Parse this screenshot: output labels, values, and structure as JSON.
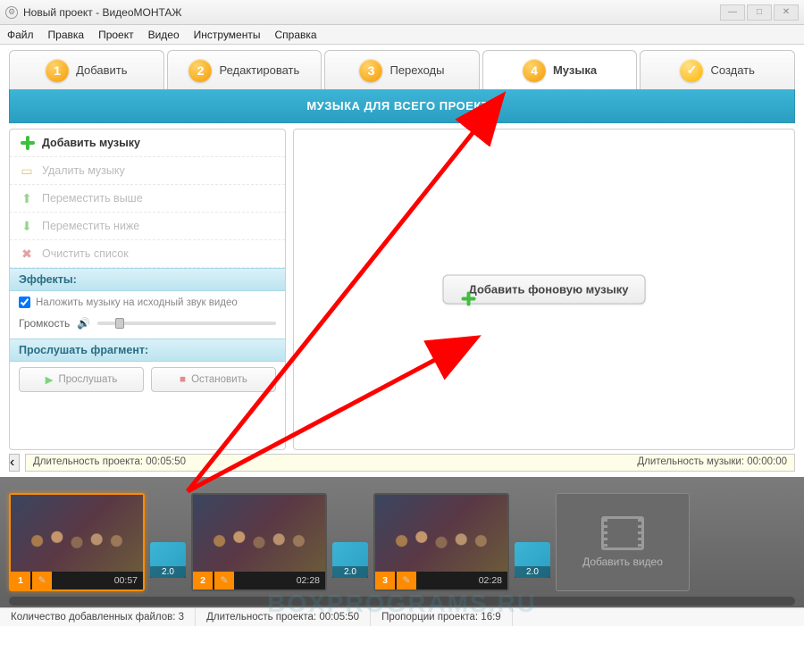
{
  "window": {
    "title": "Новый проект - ВидеоМОНТАЖ"
  },
  "menu": {
    "file": "Файл",
    "edit": "Правка",
    "project": "Проект",
    "video": "Видео",
    "tools": "Инструменты",
    "help": "Справка"
  },
  "tabs": {
    "add": "Добавить",
    "edit": "Редактировать",
    "transitions": "Переходы",
    "music": "Музыка",
    "create": "Создать"
  },
  "banner": "МУЗЫКА ДЛЯ ВСЕГО ПРОЕКТА",
  "left": {
    "add_music": "Добавить музыку",
    "delete_music": "Удалить музыку",
    "move_up": "Переместить выше",
    "move_down": "Переместить ниже",
    "clear_list": "Очистить список",
    "effects_header": "Эффекты:",
    "overlay_check": "Наложить музыку на исходный звук видео",
    "volume_label": "Громкость",
    "preview_header": "Прослушать фрагмент:",
    "play": "Прослушать",
    "stop": "Остановить"
  },
  "right": {
    "add_bg_music": "Добавить фоновую музыку"
  },
  "duration": {
    "project_label": "Длительность проекта:",
    "project_value": "00:05:50",
    "music_label": "Длительность музыки:",
    "music_value": "00:00:00"
  },
  "timeline": {
    "clips": [
      {
        "idx": "1",
        "time": "00:57"
      },
      {
        "idx": "2",
        "time": "02:28"
      },
      {
        "idx": "3",
        "time": "02:28"
      }
    ],
    "transition_dur": "2.0",
    "add_video": "Добавить видео"
  },
  "status": {
    "files_label": "Количество добавленных файлов:",
    "files_value": "3",
    "dur_label": "Длительность проекта:",
    "dur_value": "00:05:50",
    "ratio_label": "Пропорции проекта:",
    "ratio_value": "16:9"
  },
  "watermark": "BOXPROGRAMS.RU"
}
